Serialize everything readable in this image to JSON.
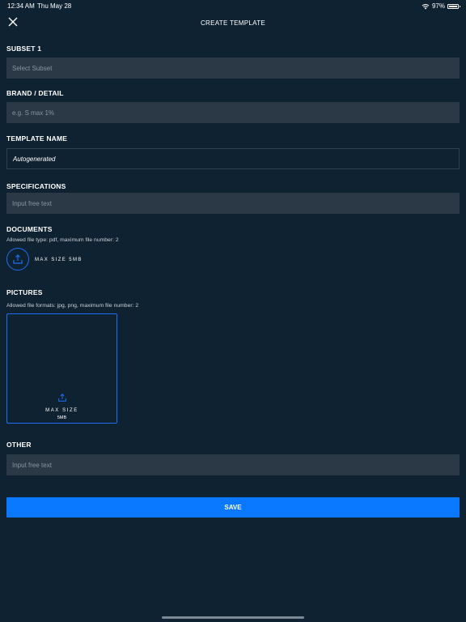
{
  "status_bar": {
    "time": "12:34 AM",
    "date": "Thu May 28",
    "battery": "97%"
  },
  "header": {
    "title": "CREATE TEMPLATE",
    "close_icon": "close-icon"
  },
  "subset": {
    "label": "SUBSET 1",
    "placeholder": "Select Subset"
  },
  "brand": {
    "label": "BRAND / DETAIL",
    "placeholder": "e.g. S max 1%"
  },
  "template_name": {
    "label": "TEMPLATE NAME",
    "value": "Autogenerated"
  },
  "specifications": {
    "label": "SPECIFICATIONS",
    "placeholder": "Input free text"
  },
  "documents": {
    "label": "DOCUMENTS",
    "helper": "Allowed file type: pdf, maximum file number: 2",
    "upload_label": "MAX SIZE 5MB",
    "icon": "upload-icon"
  },
  "pictures": {
    "label": "PICTURES",
    "helper": "Allowed file formats: jpg, png, maximum file number: 2",
    "max_label": "MAX SIZE",
    "size_label": "5MB",
    "icon": "upload-icon"
  },
  "other": {
    "label": "OTHER",
    "placeholder": "Input free text"
  },
  "save": {
    "label": "SAVE"
  },
  "colors": {
    "background": "#0f2231",
    "field": "#2b3845",
    "accent": "#0a79ff",
    "border_accent": "#1d6ff2"
  }
}
